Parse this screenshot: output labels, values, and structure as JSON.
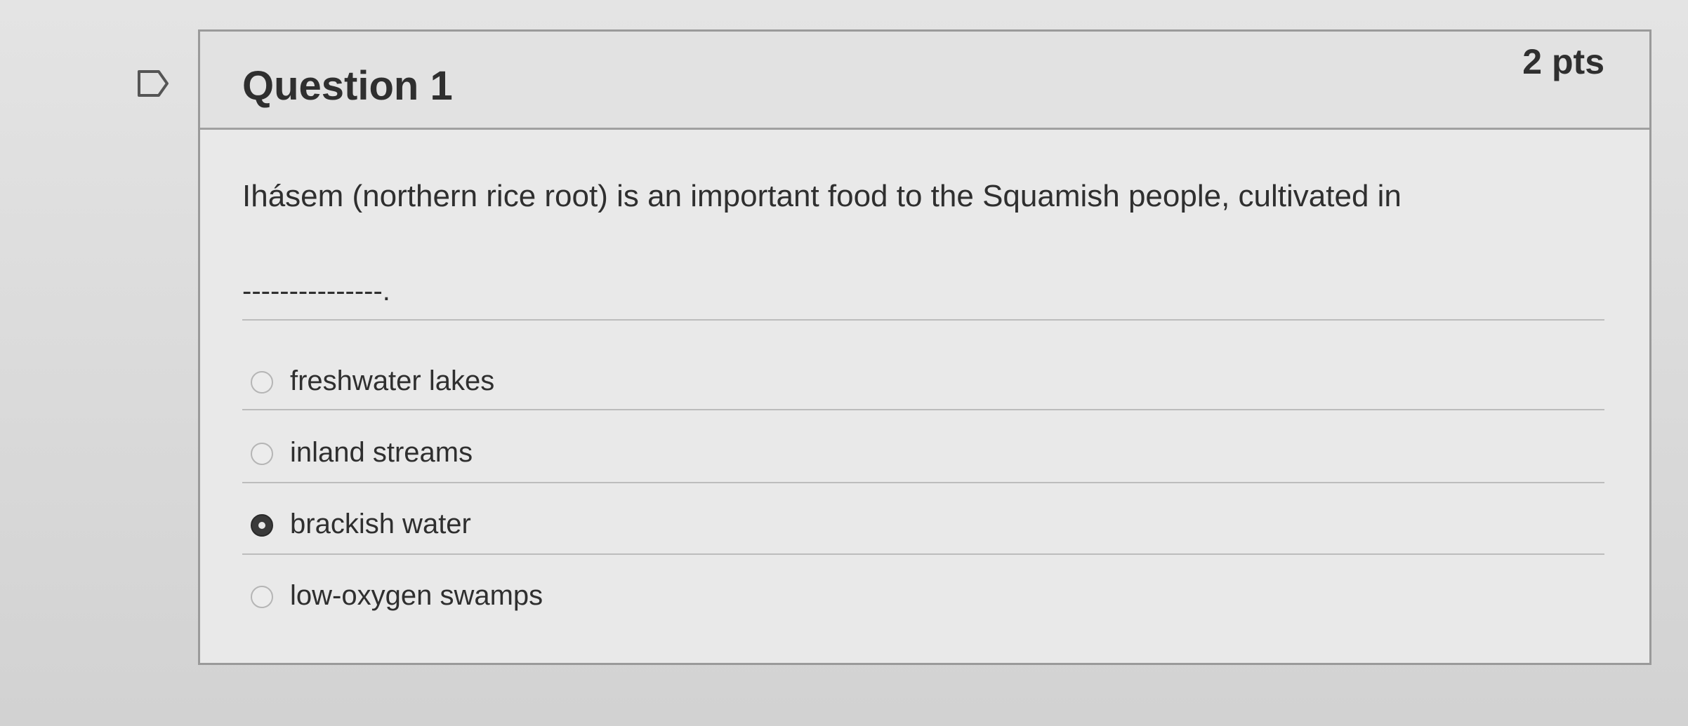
{
  "question": {
    "title": "Question 1",
    "points": "2 pts",
    "text": "Ihásem (northern rice root) is an important food to the Squamish people, cultivated in",
    "blank": "---------------."
  },
  "answers": [
    {
      "label": "freshwater lakes",
      "selected": false
    },
    {
      "label": "inland streams",
      "selected": false
    },
    {
      "label": "brackish water",
      "selected": true
    },
    {
      "label": "low-oxygen swamps",
      "selected": false
    }
  ],
  "icons": {
    "flag": "flag-outline-icon"
  },
  "colors": {
    "text": "#2f2f2f",
    "card_bg": "#e9e9e9",
    "border": "#9a9a9a",
    "selected_radio": "#3a3a3a"
  }
}
